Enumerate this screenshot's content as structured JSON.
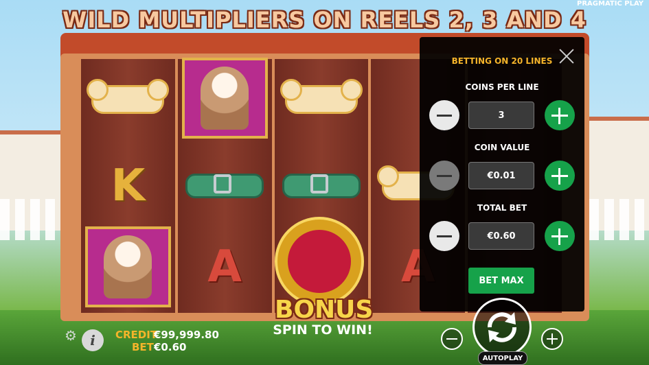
{
  "header": {
    "title": "WILD MULTIPLIERS ON REELS 2, 3 AND 4",
    "brand": "PRAGMATIC PLAY"
  },
  "reels": {
    "bonus_text": "BONUS",
    "letters": {
      "k": "K",
      "a": "A"
    }
  },
  "bet_panel": {
    "title": "BETTING ON 20 LINES",
    "coins_per_line_label": "COINS PER LINE",
    "coins_per_line_value": "3",
    "coin_value_label": "COIN VALUE",
    "coin_value_value": "€0.01",
    "total_bet_label": "TOTAL BET",
    "total_bet_value": "€0.60",
    "bet_max_label": "BET MAX"
  },
  "hud": {
    "credit_label": "CREDIT",
    "credit_value": "€99,999.80",
    "bet_label": "BET",
    "bet_value": "€0.60",
    "spin_text": "SPIN TO WIN!",
    "autoplay_label": "AUTOPLAY"
  },
  "colors": {
    "accent": "#f5b42a",
    "green": "#16a24a",
    "panel_bg": "#000000"
  }
}
